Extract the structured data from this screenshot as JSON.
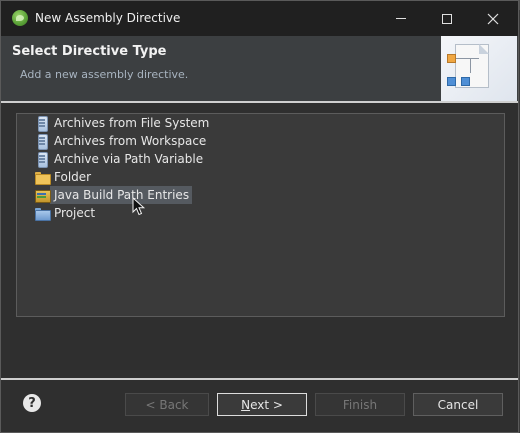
{
  "window": {
    "title": "New Assembly Directive",
    "minimize_icon": "minimize-icon",
    "maximize_icon": "maximize-icon",
    "close_icon": "close-icon"
  },
  "header": {
    "title": "Select Directive Type",
    "description": "Add a new assembly directive."
  },
  "tree": {
    "items": [
      {
        "label": "Archives from File System",
        "icon": "jar-icon",
        "selected": false
      },
      {
        "label": "Archives from Workspace",
        "icon": "jar-icon",
        "selected": false
      },
      {
        "label": "Archive via Path Variable",
        "icon": "jar-icon",
        "selected": false
      },
      {
        "label": "Folder",
        "icon": "folder-icon",
        "selected": false
      },
      {
        "label": "Java Build Path Entries",
        "icon": "build-path-icon",
        "selected": true
      },
      {
        "label": "Project",
        "icon": "project-icon",
        "selected": false
      }
    ]
  },
  "footer": {
    "help_label": "?",
    "back_label": "< Back",
    "next_label_mnemonic": "N",
    "next_label_rest": "ext >",
    "finish_label": "Finish",
    "cancel_label": "Cancel"
  },
  "colors": {
    "dialog_bg": "#2f2f2f",
    "selection": "#555a60",
    "separator": "#cfcfcf"
  }
}
